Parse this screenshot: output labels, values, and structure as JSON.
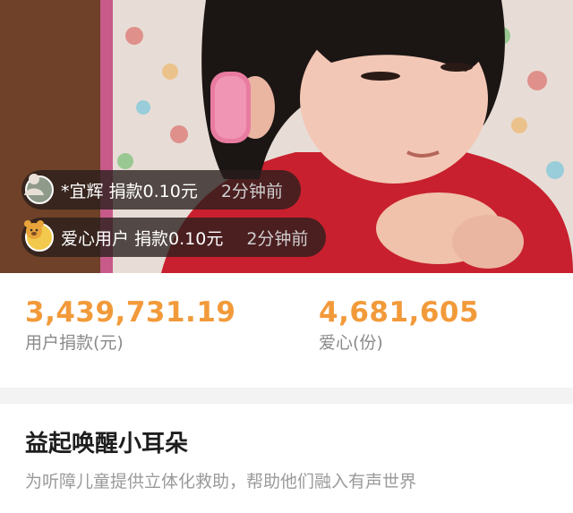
{
  "donations": [
    {
      "name": "*宜辉",
      "amount": "捐款0.10元",
      "time": "2分钟前",
      "avatar_icon": "user-photo-avatar-icon"
    },
    {
      "name": "爱心用户",
      "amount": "捐款0.10元",
      "time": "2分钟前",
      "avatar_icon": "bear-avatar-icon"
    }
  ],
  "stats": {
    "donation_total": "3,439,731.19",
    "donation_label": "用户捐款(元)",
    "love_count": "4,681,605",
    "love_label": "爱心(份)"
  },
  "project": {
    "title": "益起唤醒小耳朵",
    "description": "为听障儿童提供立体化救助，帮助他们融入有声世界"
  },
  "colors": {
    "accent": "#f29a3a",
    "label_gray": "#8b8b8b",
    "toast_bg": "rgba(40,30,28,0.78)"
  }
}
